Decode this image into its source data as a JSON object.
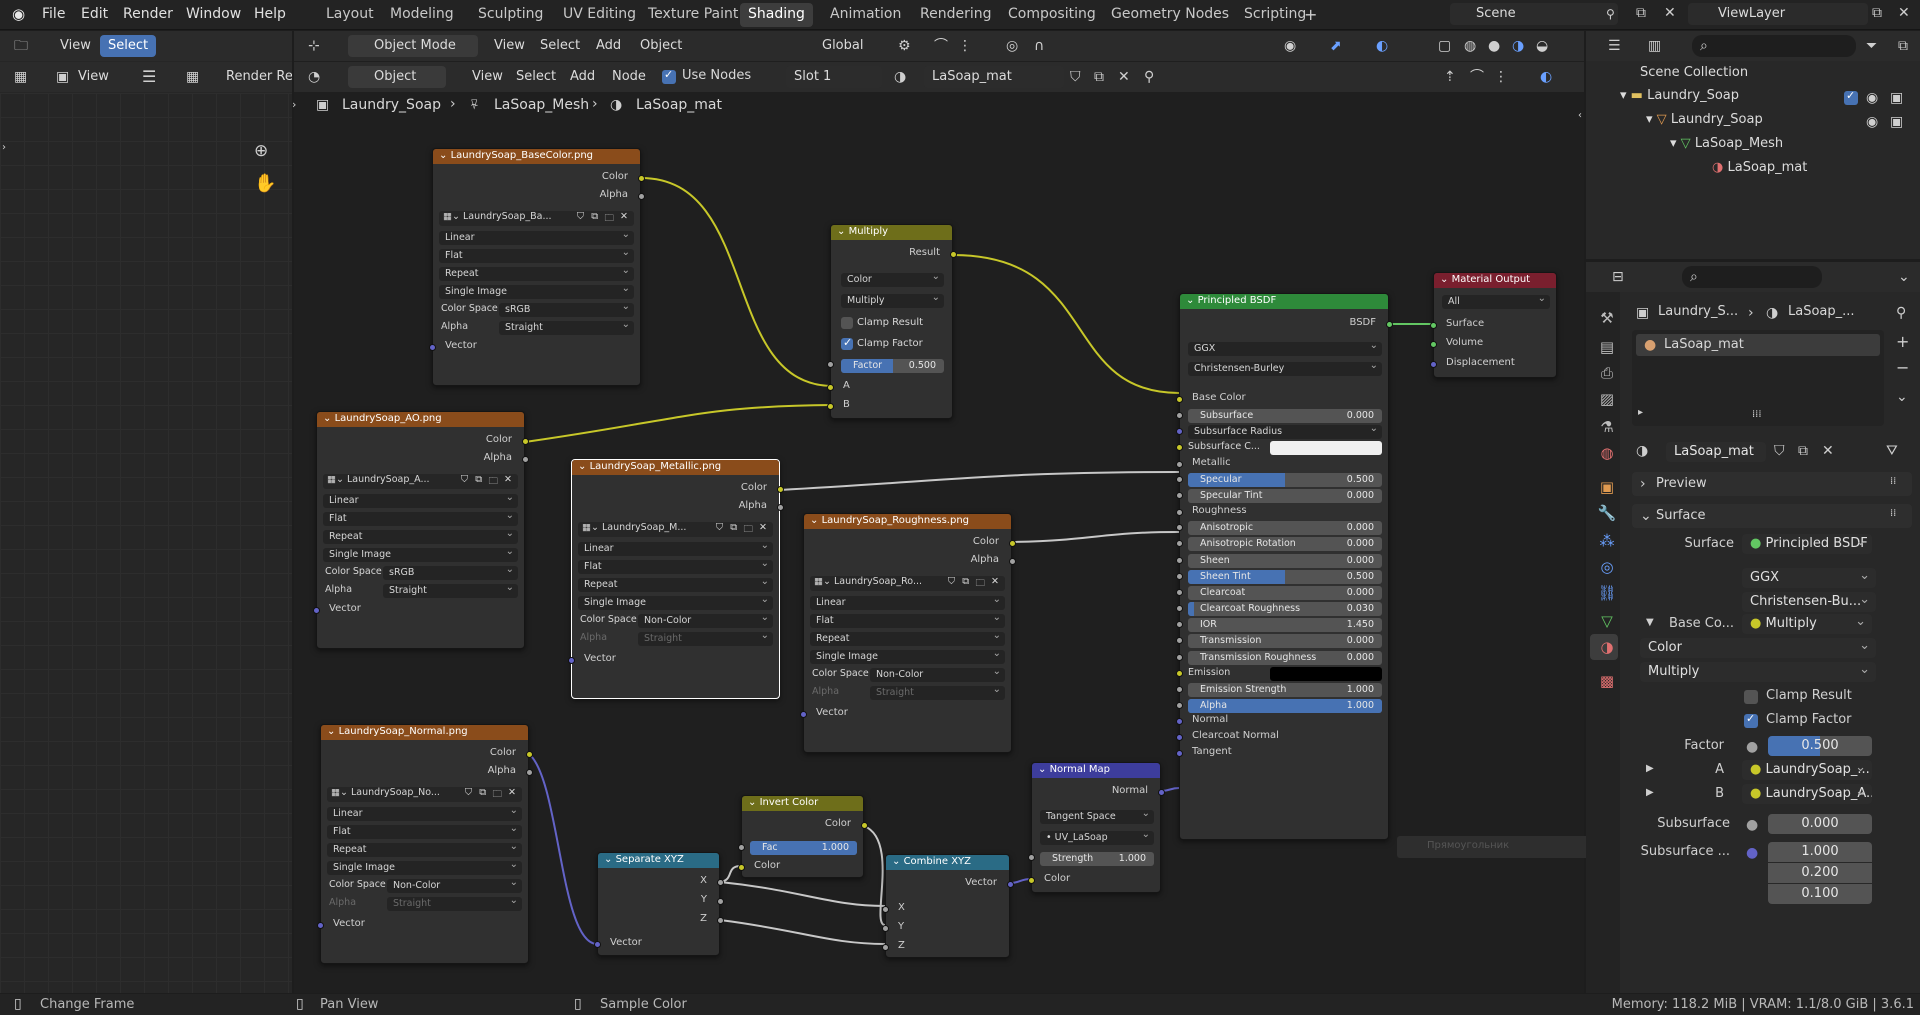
{
  "menu": {
    "file": "File",
    "edit": "Edit",
    "render": "Render",
    "window": "Window",
    "help": "Help"
  },
  "workspaces": [
    "Layout",
    "Modeling",
    "Sculpting",
    "UV Editing",
    "Texture Paint",
    "Shading",
    "Animation",
    "Rendering",
    "Compositing",
    "Geometry Nodes",
    "Scripting"
  ],
  "scene": "Scene",
  "view_layer": "ViewLayer",
  "left_header": {
    "view": "View",
    "select": "Select",
    "view2": "View",
    "render_result": "Render Re"
  },
  "viewport_header": {
    "mode": "Object Mode",
    "view": "View",
    "select": "Select",
    "add": "Add",
    "object": "Object",
    "transform": "Global"
  },
  "node_header": {
    "type": "Object",
    "view": "View",
    "select": "Select",
    "add": "Add",
    "node": "Node",
    "use_nodes": "Use Nodes",
    "slot": "Slot 1",
    "material": "LaSoap_mat"
  },
  "breadcrumb": [
    "Laundry_Soap",
    "LaSoap_Mesh",
    "LaSoap_mat"
  ],
  "nodes": {
    "basecolor": {
      "title": "LaundrySoap_BaseColor.png",
      "image": "LaundrySoap_Ba...",
      "interp": "Linear",
      "proj": "Flat",
      "ext": "Repeat",
      "src": "Single Image",
      "cs_label": "Color Space",
      "cs": "sRGB",
      "alpha_label": "Alpha",
      "alpha": "Straight",
      "out_color": "Color",
      "out_alpha": "Alpha",
      "in_vector": "Vector"
    },
    "ao": {
      "title": "LaundrySoap_AO.png",
      "image": "LaundrySoap_A...",
      "interp": "Linear",
      "proj": "Flat",
      "ext": "Repeat",
      "src": "Single Image",
      "cs_label": "Color Space",
      "cs": "sRGB",
      "alpha_label": "Alpha",
      "alpha": "Straight",
      "out_color": "Color",
      "out_alpha": "Alpha",
      "in_vector": "Vector"
    },
    "metallic": {
      "title": "LaundrySoap_Metallic.png",
      "image": "LaundrySoap_M...",
      "interp": "Linear",
      "proj": "Flat",
      "ext": "Repeat",
      "src": "Single Image",
      "cs_label": "Color Space",
      "cs": "Non-Color",
      "alpha_label": "Alpha",
      "alpha": "Straight",
      "out_color": "Color",
      "out_alpha": "Alpha",
      "in_vector": "Vector"
    },
    "roughness": {
      "title": "LaundrySoap_Roughness.png",
      "image": "LaundrySoap_Ro...",
      "interp": "Linear",
      "proj": "Flat",
      "ext": "Repeat",
      "src": "Single Image",
      "cs_label": "Color Space",
      "cs": "Non-Color",
      "alpha_label": "Alpha",
      "alpha": "Straight",
      "out_color": "Color",
      "out_alpha": "Alpha",
      "in_vector": "Vector"
    },
    "normal": {
      "title": "LaundrySoap_Normal.png",
      "image": "LaundrySoap_No...",
      "interp": "Linear",
      "proj": "Flat",
      "ext": "Repeat",
      "src": "Single Image",
      "cs_label": "Color Space",
      "cs": "Non-Color",
      "alpha_label": "Alpha",
      "alpha": "Straight",
      "out_color": "Color",
      "out_alpha": "Alpha",
      "in_vector": "Vector"
    },
    "multiply": {
      "title": "Multiply",
      "result": "Result",
      "dtype": "Color",
      "blend": "Multiply",
      "clamp_result": "Clamp Result",
      "clamp_factor": "Clamp Factor",
      "factor_label": "Factor",
      "factor": "0.500",
      "factor_fill": 0.5,
      "a": "A",
      "b": "B"
    },
    "bsdf": {
      "title": "Principled BSDF",
      "out": "BSDF",
      "dist": "GGX",
      "sss": "Christensen-Burley",
      "base_color": "Base Color",
      "subsurface": "Subsurface",
      "subsurface_v": "0.000",
      "subsurface_radius": "Subsurface Radius",
      "subsurface_color": "Subsurface C...",
      "metallic": "Metallic",
      "specular": "Specular",
      "specular_v": "0.500",
      "specular_fill": 0.5,
      "spec_tint": "Specular Tint",
      "spec_tint_v": "0.000",
      "roughness": "Roughness",
      "aniso": "Anisotropic",
      "aniso_v": "0.000",
      "aniso_rot": "Anisotropic Rotation",
      "aniso_rot_v": "0.000",
      "sheen": "Sheen",
      "sheen_v": "0.000",
      "sheen_tint": "Sheen Tint",
      "sheen_tint_v": "0.500",
      "sheen_tint_fill": 0.5,
      "clearcoat": "Clearcoat",
      "clearcoat_v": "0.000",
      "cc_rough": "Clearcoat Roughness",
      "cc_rough_v": "0.030",
      "cc_rough_fill": 0.03,
      "ior": "IOR",
      "ior_v": "1.450",
      "transmission": "Transmission",
      "transmission_v": "0.000",
      "trans_rough": "Transmission Roughness",
      "trans_rough_v": "0.000",
      "emission": "Emission",
      "emission_strength": "Emission Strength",
      "emission_strength_v": "1.000",
      "alpha": "Alpha",
      "alpha_v": "1.000",
      "alpha_fill": 1.0,
      "normal": "Normal",
      "cc_normal": "Clearcoat Normal",
      "tangent": "Tangent"
    },
    "output": {
      "title": "Material Output",
      "target": "All",
      "surface": "Surface",
      "volume": "Volume",
      "displacement": "Displacement"
    },
    "normalmap": {
      "title": "Normal Map",
      "out": "Normal",
      "space": "Tangent Space",
      "uv": "UV_LaSoap",
      "strength_label": "Strength",
      "strength": "1.000",
      "color": "Color"
    },
    "invert": {
      "title": "Invert Color",
      "out": "Color",
      "fac_label": "Fac",
      "fac": "1.000",
      "color": "Color"
    },
    "separate": {
      "title": "Separate XYZ",
      "x": "X",
      "y": "Y",
      "z": "Z",
      "vector": "Vector"
    },
    "combine": {
      "title": "Combine XYZ",
      "vector": "Vector",
      "x": "X",
      "y": "Y",
      "z": "Z"
    }
  },
  "tooltip_ghost": "Прямоугольник",
  "outliner": {
    "root": "Scene Collection",
    "collection": "Laundry_Soap",
    "object": "Laundry_Soap",
    "mesh": "LaSoap_Mesh",
    "material": "LaSoap_mat"
  },
  "properties": {
    "crumb_obj": "Laundry_S...",
    "crumb_mat": "LaSoap_...",
    "slot": "LaSoap_mat",
    "material": "LaSoap_mat",
    "preview": "Preview",
    "surface_panel": "Surface",
    "surface_label": "Surface",
    "surface_value": "Principled BSDF",
    "dist": "GGX",
    "sss": "Christensen-Bu...",
    "base_color_label": "Base Co...",
    "base_color_value": "Multiply",
    "dtype": "Color",
    "blend": "Multiply",
    "clamp_result": "Clamp Result",
    "clamp_factor": "Clamp Factor",
    "factor_label": "Factor",
    "factor": "0.500",
    "a_label": "A",
    "a_value": "LaundrySoap_...",
    "b_label": "B",
    "b_value": "LaundrySoap_A...",
    "subsurface_label": "Subsurface",
    "subsurface": "0.000",
    "subsurface_r_label": "Subsurface ...",
    "r1": "1.000",
    "r2": "0.200",
    "r3": "0.100"
  },
  "status": {
    "left": "Change Frame",
    "mid": "Pan View",
    "right": "Sample Color",
    "info": "Memory: 118.2 MiB | VRAM: 1.1/8.0 GiB | 3.6.1"
  }
}
